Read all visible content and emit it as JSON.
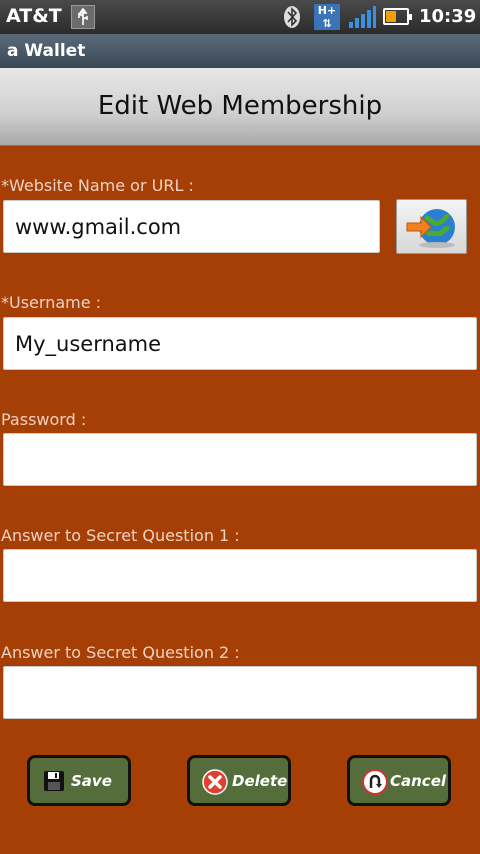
{
  "status_bar": {
    "carrier": "AT&T",
    "network_badge": "H+",
    "time": "10:39",
    "icons": [
      "usb-icon",
      "bluetooth-icon",
      "hplus-network-icon",
      "signal-icon",
      "battery-charging-icon"
    ]
  },
  "app_title": "a Wallet",
  "page_title": "Edit Web Membership",
  "fields": {
    "website": {
      "label": "*Website Name or URL :",
      "value": "www.gmail.com"
    },
    "username": {
      "label": "*Username :",
      "value": "My_username"
    },
    "password": {
      "label": "Password :",
      "value": ""
    },
    "secret1": {
      "label": "Answer to Secret Question 1 :",
      "value": ""
    },
    "secret2": {
      "label": "Answer to Secret Question 2 :",
      "value": ""
    }
  },
  "globe_button_icon": "globe-arrow-icon",
  "buttons": {
    "save": {
      "label": "Save",
      "icon": "floppy-disk-icon"
    },
    "delete": {
      "label": "Delete",
      "icon": "red-x-icon"
    },
    "cancel": {
      "label": "Cancel",
      "icon": "undo-arrow-icon"
    }
  },
  "colors": {
    "background": "#A63F06",
    "button_fill": "#556D3B",
    "label_text": "#F0D2C2"
  }
}
